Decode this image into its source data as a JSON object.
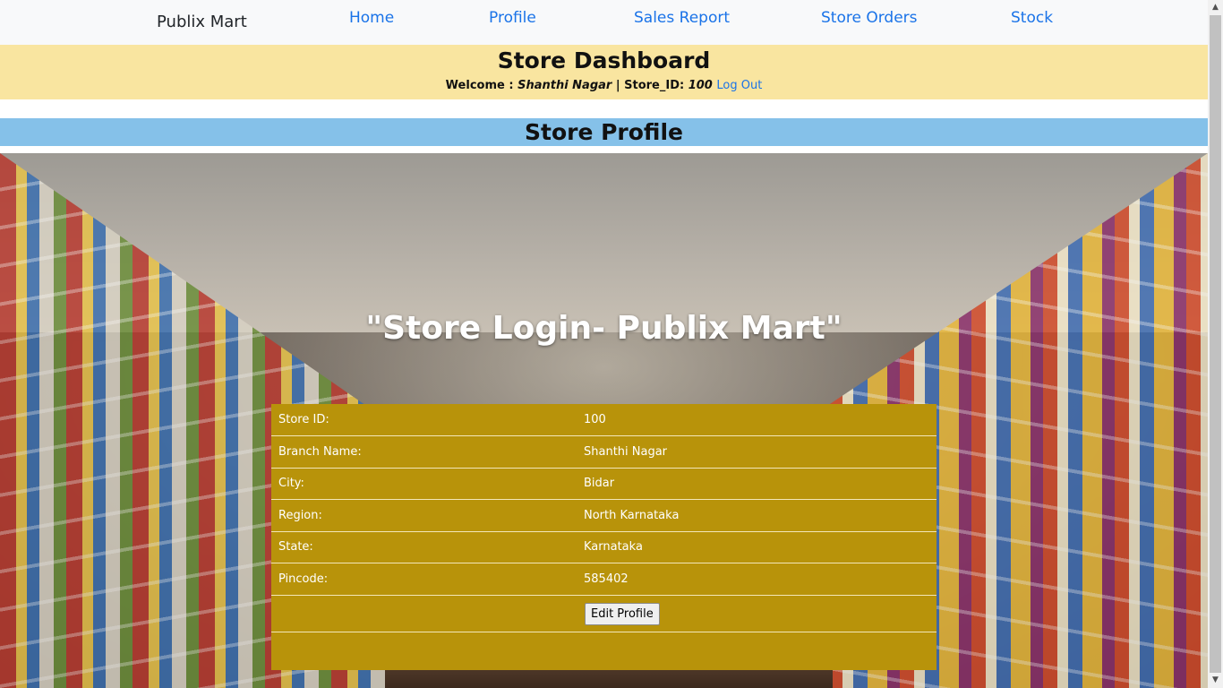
{
  "nav": {
    "brand": "Publix Mart",
    "links": [
      "Home",
      "Profile",
      "Sales Report",
      "Store Orders",
      "Stock"
    ]
  },
  "dashboard": {
    "title": "Store Dashboard",
    "welcome_prefix": "Welcome : ",
    "branch": "Shanthi Nagar",
    "separator": " | Store_ID: ",
    "store_id": "100",
    "logout": "Log Out"
  },
  "profile_strip": {
    "title": "Store Profile"
  },
  "hero": {
    "title": "\"Store Login- Publix Mart\""
  },
  "profile": {
    "rows": [
      {
        "label": "Store ID:",
        "value": "100"
      },
      {
        "label": "Branch Name:",
        "value": "Shanthi Nagar"
      },
      {
        "label": "City:",
        "value": "Bidar"
      },
      {
        "label": "Region:",
        "value": "North Karnataka"
      },
      {
        "label": "State:",
        "value": "Karnataka"
      },
      {
        "label": "Pincode:",
        "value": "585402"
      }
    ],
    "edit_button": "Edit Profile"
  },
  "colors": {
    "nav_bg": "#f8f9fa",
    "link": "#1a73e8",
    "dashboard_bg": "#f9e5a0",
    "profile_strip_bg": "#85c1e9",
    "card_bg": "#b8930a"
  }
}
